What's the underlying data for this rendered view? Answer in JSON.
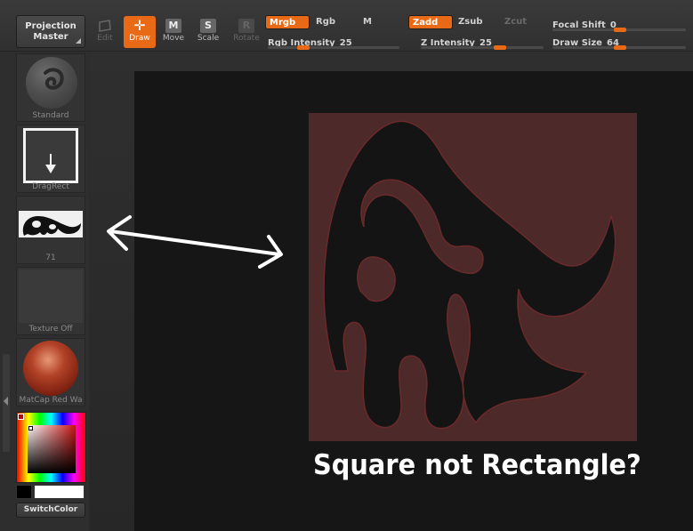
{
  "toolbar": {
    "projection_master": {
      "line1": "Projection",
      "line2": "Master"
    },
    "tools": [
      {
        "label": "Edit",
        "glyph": "",
        "icon": "edit-icon",
        "state": "disabled"
      },
      {
        "label": "Draw",
        "glyph": "✛",
        "icon": "draw-icon",
        "state": "active"
      },
      {
        "label": "Move",
        "glyph": "M",
        "icon": "move-icon",
        "state": "normal"
      },
      {
        "label": "Scale",
        "glyph": "S",
        "icon": "scale-icon",
        "state": "normal"
      },
      {
        "label": "Rotate",
        "glyph": "R",
        "icon": "rotate-icon",
        "state": "disabled"
      }
    ],
    "mrgb": "Mrgb",
    "rgb": "Rgb",
    "m": "M",
    "zadd": "Zadd",
    "zsub": "Zsub",
    "zcut": "Zcut",
    "rgb_intensity": {
      "label": "Rgb  Intensity",
      "value": "25",
      "fraction": 0.25
    },
    "z_intensity": {
      "label": "Z  Intensity",
      "value": "25",
      "fraction": 0.25
    },
    "focal_shift": {
      "label": "Focal  Shift",
      "value": "0",
      "fraction": 0.5
    },
    "draw_size": {
      "label": "Draw  Size",
      "value": "64",
      "fraction": 0.5
    }
  },
  "tray": {
    "brush_label": "Standard",
    "stroke_label": "DragRect",
    "alpha_label": "71",
    "texture_label": "Texture  Off",
    "material_label": "MatCap  Red  Wa",
    "switch_color": "SwitchColor"
  },
  "canvas": {
    "annotation": "Square not Rectangle?"
  },
  "colors": {
    "accent": "#e86a16",
    "texture_bg": "#4d2929",
    "main_color": "#ffffff",
    "secondary_color": "#000000"
  }
}
